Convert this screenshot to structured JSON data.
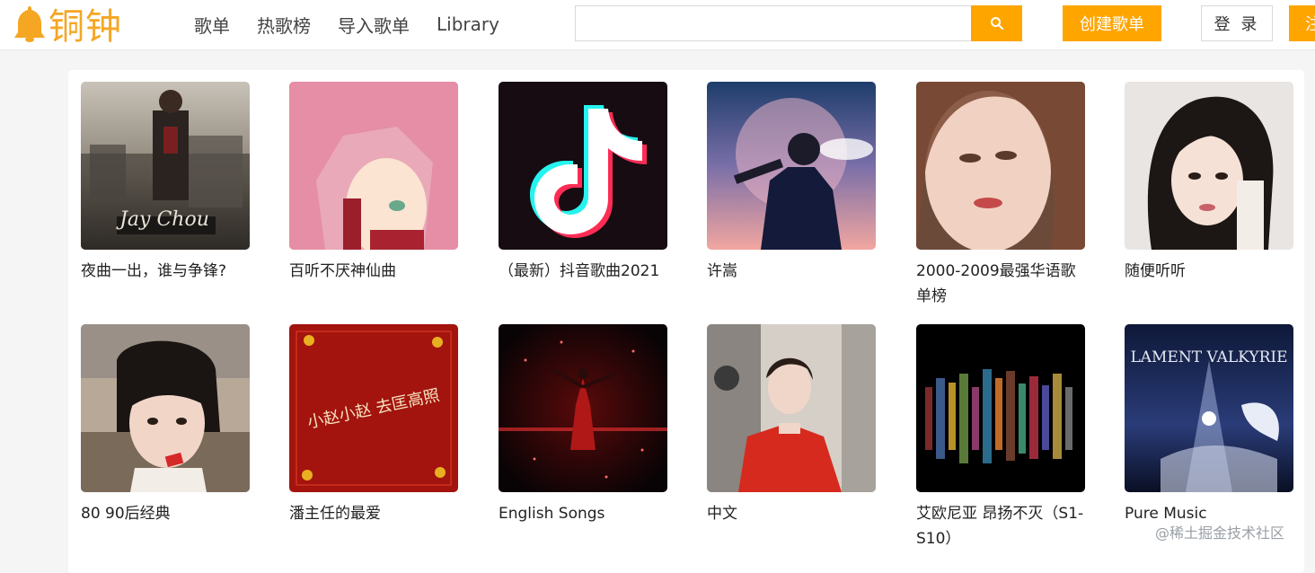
{
  "app": {
    "logo_text": "铜钟"
  },
  "nav": {
    "items": [
      "歌单",
      "热歌榜",
      "导入歌单",
      "Library"
    ]
  },
  "search": {
    "placeholder": "",
    "value": ""
  },
  "header_buttons": {
    "create": "创建歌单",
    "login": "登 录",
    "register": "注"
  },
  "playlists": [
    {
      "title": "夜曲一出，谁与争锋?",
      "cover_text": "Jay Chou"
    },
    {
      "title": "百听不厌神仙曲"
    },
    {
      "title": "（最新）抖音歌曲2021"
    },
    {
      "title": "许嵩"
    },
    {
      "title": "2000-2009最强华语歌单榜"
    },
    {
      "title": "随便听听"
    },
    {
      "title": "80 90后经典"
    },
    {
      "title": "潘主任的最爱",
      "cover_text": "小赵小赵 去匡高照"
    },
    {
      "title": "English Songs"
    },
    {
      "title": "中文"
    },
    {
      "title": "艾欧尼亚 昂扬不灭（S1-S10）"
    },
    {
      "title": "Pure Music",
      "cover_text": "LAMENT VALKYRIE"
    }
  ],
  "watermark": "@稀土掘金技术社区",
  "colors": {
    "accent": "#ffa500",
    "logo": "#f5a623"
  }
}
